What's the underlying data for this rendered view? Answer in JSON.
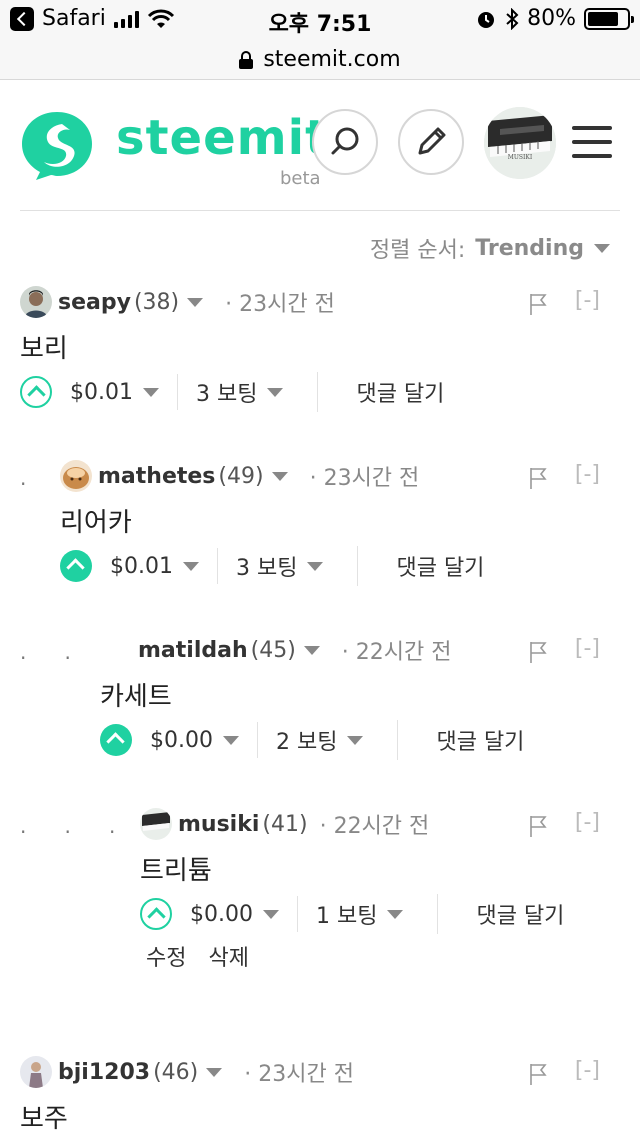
{
  "status_bar": {
    "back_app": "Safari",
    "time": "오후 7:51",
    "battery": "80%",
    "battery_level": 0.8
  },
  "url_bar": {
    "domain": "steemit.com"
  },
  "header": {
    "logo_text": "steemit",
    "beta": "beta",
    "avatar_label": "MUSIKI"
  },
  "sort": {
    "label": "정렬 순서:",
    "value": "Trending"
  },
  "comments": [
    {
      "author": "seapy",
      "rep": "(38)",
      "time": "23시간 전",
      "body": "보리",
      "payout": "$0.01",
      "votes": "3 보팅",
      "reply": "댓글 달기",
      "collapse": "[-]"
    },
    {
      "author": "mathetes",
      "rep": "(49)",
      "time": "23시간 전",
      "body": "리어카",
      "payout": "$0.01",
      "votes": "3 보팅",
      "reply": "댓글 달기",
      "collapse": "[-]"
    },
    {
      "author": "matildah",
      "rep": "(45)",
      "time": "22시간 전",
      "body": "카세트",
      "payout": "$0.00",
      "votes": "2 보팅",
      "reply": "댓글 달기",
      "collapse": "[-]"
    },
    {
      "author": "musiki",
      "rep": "(41)",
      "time": "22시간 전",
      "body": "트리튬",
      "payout": "$0.00",
      "votes": "1 보팅",
      "reply": "댓글 달기",
      "collapse": "[-]",
      "edit": "수정",
      "delete": "삭제"
    },
    {
      "author": "bji1203",
      "rep": "(46)",
      "time": "23시간 전",
      "body": "보주",
      "collapse": "[-]"
    }
  ],
  "colors": {
    "accent": "#1fd1a1",
    "muted": "#888888"
  }
}
